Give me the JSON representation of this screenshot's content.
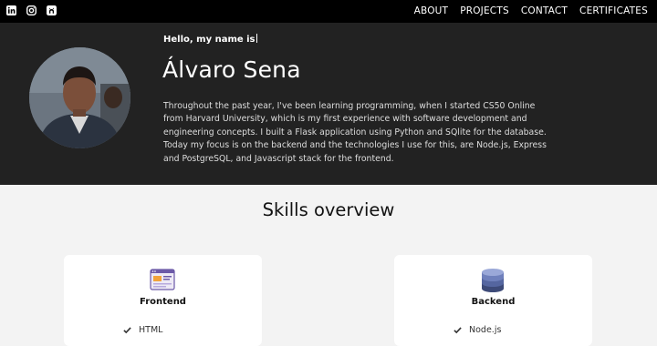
{
  "nav": {
    "links": [
      "ABOUT",
      "PROJECTS",
      "CONTACT",
      "CERTIFICATES"
    ]
  },
  "social": {
    "icons": [
      "linkedin-icon",
      "instagram-icon",
      "github-icon"
    ]
  },
  "hero": {
    "greeting": "Hello, my name is",
    "name": "Álvaro Sena",
    "bio": "Throughout the past year, I've been learning programming, when I started CS50 Online from Harvard University, which is my first experience with software development and engineering concepts. I built a Flask application using Python and SQlite for the database. Today my focus is on the backend and the technologies I use for this, are Node.js, Express and PostgreSQL, and Javascript stack for the frontend."
  },
  "skills": {
    "title": "Skills overview",
    "cards": [
      {
        "title": "Frontend",
        "items": [
          "HTML"
        ],
        "icon": "frontend-window-icon"
      },
      {
        "title": "Backend",
        "items": [
          "Node.js"
        ],
        "icon": "database-icon"
      }
    ]
  },
  "colors": {
    "topbar": "#000000",
    "hero": "#222222",
    "page": "#f3f3f3"
  }
}
